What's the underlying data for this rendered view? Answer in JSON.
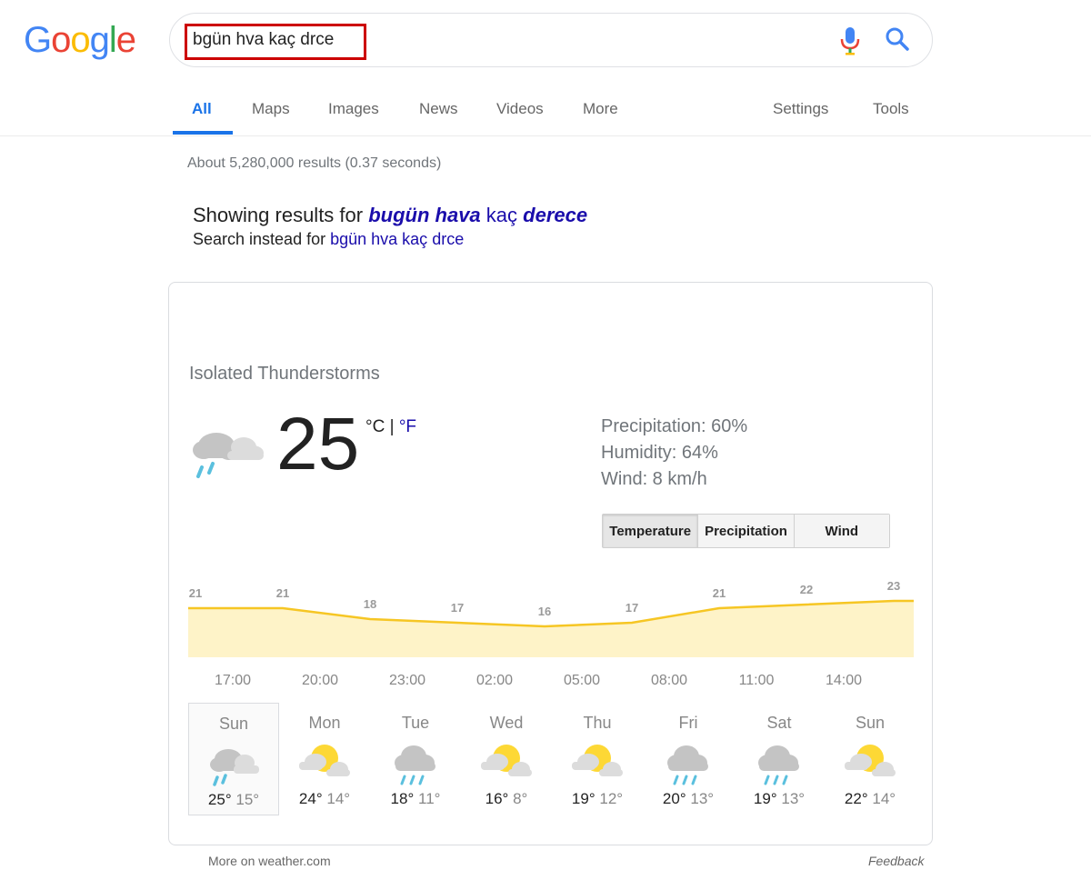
{
  "logo": {
    "letters": [
      "G",
      "o",
      "o",
      "g",
      "l",
      "e"
    ],
    "colors": [
      "#4285F4",
      "#EA4335",
      "#FBBC05",
      "#4285F4",
      "#34A853",
      "#EA4335"
    ]
  },
  "search": {
    "query": "bgün hva kaç drce",
    "highlight_color": "#cc0000"
  },
  "tabs": [
    {
      "label": "All",
      "active": true
    },
    {
      "label": "Maps"
    },
    {
      "label": "Images"
    },
    {
      "label": "News"
    },
    {
      "label": "Videos"
    },
    {
      "label": "More"
    },
    {
      "label": "Settings"
    },
    {
      "label": "Tools"
    }
  ],
  "result_stats": "About 5,280,000 results (0.37 seconds)",
  "spelling": {
    "showing_prefix": "Showing results for",
    "corrected": [
      "bugün hava",
      "kaç",
      "derece"
    ],
    "instead_prefix": "Search instead for",
    "original": "bgün hva kaç drce"
  },
  "weather": {
    "condition": "Isolated Thunderstorms",
    "temperature": "25",
    "unit_c": "°C",
    "unit_sep": "|",
    "unit_f": "°F",
    "precipitation": "Precipitation: 60%",
    "humidity": "Humidity: 64%",
    "wind": "Wind: 8 km/h",
    "toggle": [
      "Temperature",
      "Precipitation",
      "Wind"
    ],
    "selected_toggle": "Temperature"
  },
  "chart_data": {
    "type": "area",
    "x": [
      "17:00",
      "20:00",
      "23:00",
      "02:00",
      "05:00",
      "08:00",
      "11:00",
      "14:00",
      "17:00"
    ],
    "tick_labels": [
      "17:00",
      "20:00",
      "23:00",
      "02:00",
      "05:00",
      "08:00",
      "11:00",
      "14:00"
    ],
    "values": [
      21,
      21,
      18,
      17,
      16,
      17,
      21,
      22,
      23
    ],
    "ylim": [
      0,
      25
    ],
    "line_color": "#f6c624",
    "fill_color": "#fef3c8",
    "grid": false
  },
  "forecast": [
    {
      "day": "Sun",
      "hi": "25°",
      "lo": "15°",
      "icon": "thunderstorm-rain-icon",
      "selected": true
    },
    {
      "day": "Mon",
      "hi": "24°",
      "lo": "14°",
      "icon": "partly-cloudy-icon"
    },
    {
      "day": "Tue",
      "hi": "18°",
      "lo": "11°",
      "icon": "cloud-rain-icon"
    },
    {
      "day": "Wed",
      "hi": "16°",
      "lo": "8°",
      "icon": "partly-cloudy-icon"
    },
    {
      "day": "Thu",
      "hi": "19°",
      "lo": "12°",
      "icon": "partly-cloudy-icon"
    },
    {
      "day": "Fri",
      "hi": "20°",
      "lo": "13°",
      "icon": "cloud-rain-icon"
    },
    {
      "day": "Sat",
      "hi": "19°",
      "lo": "13°",
      "icon": "cloud-rain-icon"
    },
    {
      "day": "Sun",
      "hi": "22°",
      "lo": "14°",
      "icon": "partly-cloudy-icon"
    }
  ],
  "footer": {
    "more": "More on weather.com",
    "feedback": "Feedback"
  }
}
